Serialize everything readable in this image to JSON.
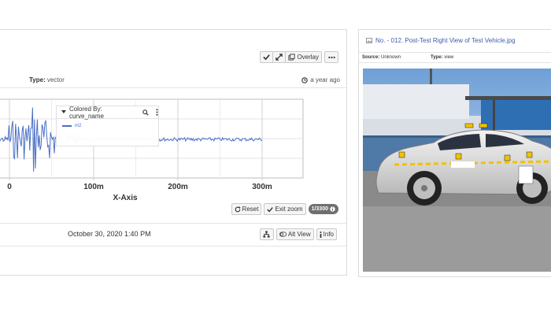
{
  "left_panel": {
    "toolbar": {
      "overlay_label": "Overlay"
    },
    "type_label": "Type:",
    "type_value": "vector",
    "age": "a year ago",
    "legend": {
      "title": "Colored By: curve_name",
      "items": [
        "m2"
      ]
    },
    "zoom": {
      "reset_label": "Reset",
      "exit_label": "Exit zoom",
      "counter": "1/3300"
    },
    "date": "October 30, 2020 1:40 PM",
    "actions": {
      "alt_view_label": "Alt View",
      "info_label": "Info"
    }
  },
  "chart_data": {
    "type": "line",
    "x_ticks": [
      "0",
      "100m",
      "200m",
      "300m"
    ],
    "xlabel": "X-Axis",
    "ylabel": "",
    "grid": true,
    "series": [
      {
        "name": "m2",
        "color": "#4a6fc7"
      }
    ]
  },
  "right_panel": {
    "title": "No. - 012. Post-Test Right View of Test Vehicle.jpg",
    "source_label": "Source:",
    "source_value": "Unknown",
    "type_label": "Type:",
    "type_value": "view"
  },
  "colors": {
    "series": "#4a6fc7",
    "link": "#3d5ca8",
    "pill": "#6f6f6f"
  }
}
